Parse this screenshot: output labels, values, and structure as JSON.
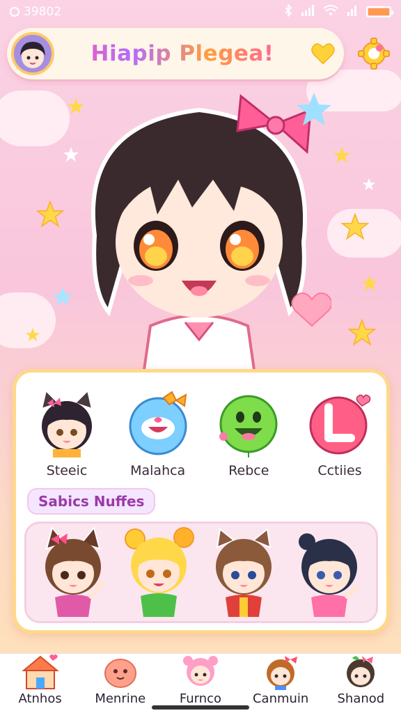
{
  "status_bar": {
    "time": "39802",
    "battery_level": 1.0
  },
  "header": {
    "title": "Hiapip Plegea!"
  },
  "stickers": [
    {
      "label": "Steeic",
      "icon": "cat-girl-sticker-icon"
    },
    {
      "label": "Malahca",
      "icon": "blue-bubble-face-icon"
    },
    {
      "label": "Rebce",
      "icon": "green-smile-face-icon"
    },
    {
      "label": "Cctiies",
      "icon": "pink-l-badge-icon"
    }
  ],
  "section": {
    "title": "Sabics Nuffes"
  },
  "friends": [
    {
      "name": "friend-brown-cat-ears",
      "icon": "cat-ear-girl-icon"
    },
    {
      "name": "friend-blonde",
      "icon": "blonde-girl-icon"
    },
    {
      "name": "friend-bear-ears",
      "icon": "bear-ear-girl-icon"
    },
    {
      "name": "friend-navy-hair",
      "icon": "navy-hair-girl-icon"
    }
  ],
  "nav": [
    {
      "label": "Atnhos",
      "icon": "house-icon"
    },
    {
      "label": "Menrine",
      "icon": "pink-blob-icon"
    },
    {
      "label": "Furnco",
      "icon": "pink-bear-girl-icon"
    },
    {
      "label": "Canmuin",
      "icon": "bow-girl-icon"
    },
    {
      "label": "Shanod",
      "icon": "leaf-girl-icon"
    }
  ],
  "colors": {
    "accent_pink": "#ff5fa2",
    "card_border": "#ffd88a",
    "section_text": "#9b3aa8"
  }
}
